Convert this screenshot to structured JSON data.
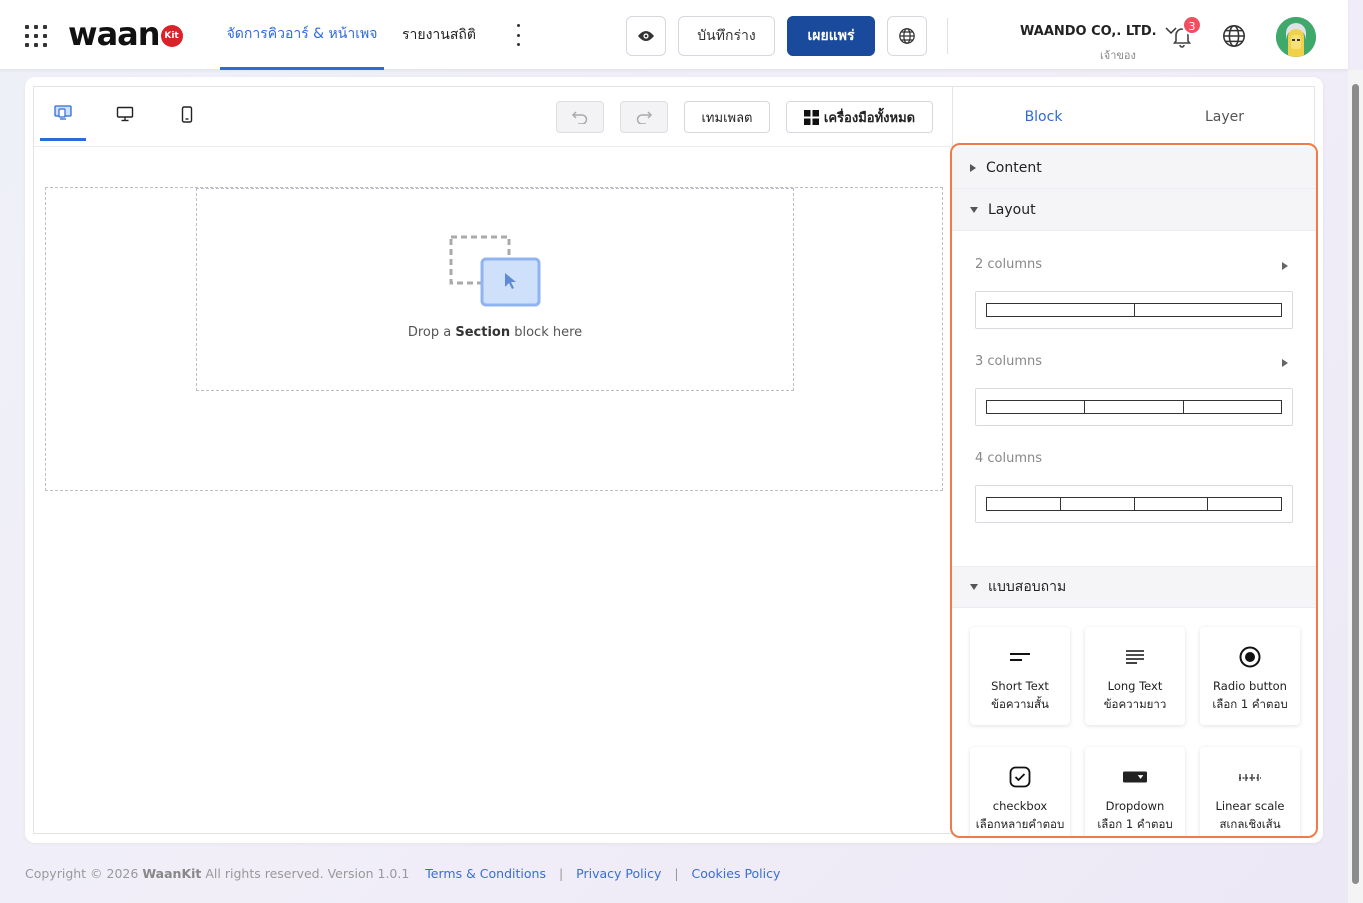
{
  "header": {
    "logo_text": "waan",
    "logo_badge": "Kit",
    "nav": [
      {
        "label": "จัดการคิวอาร์ & หน้าเพจ",
        "active": true
      },
      {
        "label": "รายงานสถิติ",
        "active": false
      }
    ],
    "save_draft_label": "บันทึกร่าง",
    "publish_label": "เผยแพร่",
    "company_name": "WAANDO CO,. LTD.",
    "company_role": "เจ้าของ",
    "notification_count": "3",
    "accent_color": "#2f6bd8",
    "primary_button_color": "#1a4a9c"
  },
  "toolbar": {
    "template_label": "เทมเพลต",
    "all_tools_label": "เครื่องมือทั้งหมด"
  },
  "canvas": {
    "drop_prefix": "Drop a",
    "drop_bold": "Section",
    "drop_suffix": "block here"
  },
  "panel": {
    "tabs": [
      {
        "label": "Block",
        "active": true
      },
      {
        "label": "Layer",
        "active": false
      }
    ],
    "sections": {
      "content": "Content",
      "layout": "Layout",
      "survey": "แบบสอบถาม"
    },
    "layout_items": [
      {
        "label": "2 columns",
        "columns": 2
      },
      {
        "label": "3 columns",
        "columns": 3
      },
      {
        "label": "4 columns",
        "columns": 4
      }
    ],
    "survey_items": [
      {
        "title": "Short Text",
        "subtitle": "ข้อความสั้น",
        "icon": "short-text-icon"
      },
      {
        "title": "Long Text",
        "subtitle": "ข้อความยาว",
        "icon": "long-text-icon"
      },
      {
        "title": "Radio button",
        "subtitle": "เลือก 1 คำตอบ",
        "icon": "radio-icon"
      },
      {
        "title": "checkbox",
        "subtitle": "เลือกหลายคำตอบ",
        "icon": "checkbox-icon"
      },
      {
        "title": "Dropdown",
        "subtitle": "เลือก 1 คำตอบ",
        "icon": "dropdown-icon"
      },
      {
        "title": "Linear scale",
        "subtitle": "สเกลเชิงเส้น",
        "icon": "linear-scale-icon"
      }
    ],
    "highlight_color": "#f07a4a"
  },
  "footer": {
    "copyright_prefix": "Copyright © 2026",
    "brand": "WaanKit",
    "copyright_suffix": "All rights reserved. Version 1.0.1",
    "links": [
      "Terms & Conditions",
      "Privacy Policy",
      "Cookies Policy"
    ]
  }
}
